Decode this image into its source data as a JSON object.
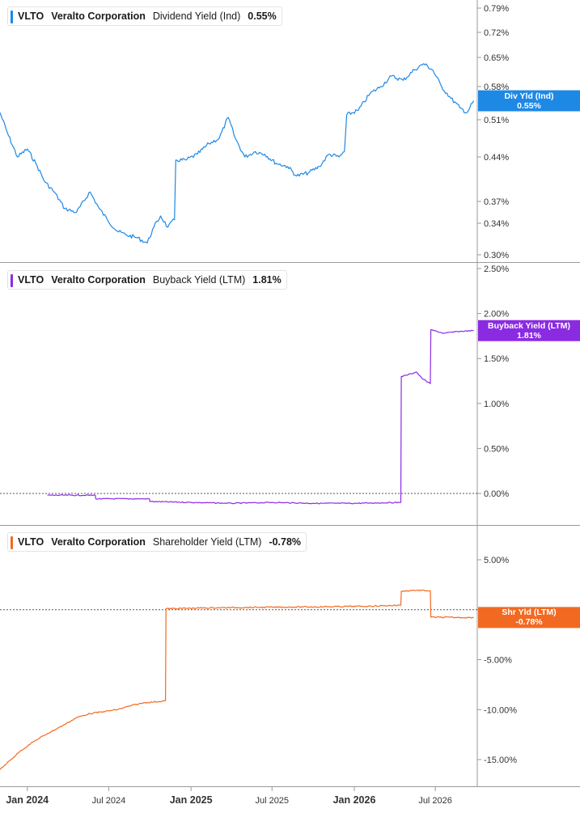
{
  "colors": {
    "dividend": "#1e88e5",
    "buyback": "#8a2be2",
    "shareholder": "#f26a21",
    "grid": "#c8c8c8",
    "axis_text": "#333333"
  },
  "legends": [
    {
      "ticker": "VLTO",
      "company": "Veralto Corporation",
      "metric": "Dividend Yield (Ind)",
      "value": "0.55%"
    },
    {
      "ticker": "VLTO",
      "company": "Veralto Corporation",
      "metric": "Buyback Yield (LTM)",
      "value": "1.81%"
    },
    {
      "ticker": "VLTO",
      "company": "Veralto Corporation",
      "metric": "Shareholder Yield (LTM)",
      "value": "-0.78%"
    }
  ],
  "flags": [
    {
      "line1": "Div Yld (Ind)",
      "line2": "0.55%"
    },
    {
      "line1": "Buyback Yield (LTM)",
      "line2": "1.81%"
    },
    {
      "line1": "Shr Yld (LTM)",
      "line2": "-0.78%"
    }
  ],
  "x_axis": {
    "labels": [
      {
        "text": "Jan 2024",
        "date": "2024-01-01",
        "bold": true
      },
      {
        "text": "Jul 2024",
        "date": "2024-07-01",
        "bold": false
      },
      {
        "text": "Jan 2025",
        "date": "2025-01-01",
        "bold": true
      },
      {
        "text": "Jul 2025",
        "date": "2025-07-01",
        "bold": false
      },
      {
        "text": "Jan 2026",
        "date": "2026-01-01",
        "bold": true
      },
      {
        "text": "Jul 2026",
        "date": "2026-07-01",
        "bold": false
      }
    ]
  },
  "chart_data": [
    {
      "type": "line",
      "series": [
        {
          "name": "Dividend Yield (Ind)",
          "points": [
            [
              "2023-11-01",
              0.525
            ],
            [
              "2023-11-20",
              0.48
            ],
            [
              "2023-12-10",
              0.44
            ],
            [
              "2024-01-01",
              0.455
            ],
            [
              "2024-01-20",
              0.43
            ],
            [
              "2024-02-10",
              0.4
            ],
            [
              "2024-03-01",
              0.385
            ],
            [
              "2024-03-25",
              0.36
            ],
            [
              "2024-04-20",
              0.355
            ],
            [
              "2024-05-20",
              0.385
            ],
            [
              "2024-06-10",
              0.36
            ],
            [
              "2024-06-28",
              0.345
            ],
            [
              "2024-07-20",
              0.33
            ],
            [
              "2024-08-10",
              0.325
            ],
            [
              "2024-09-01",
              0.322
            ],
            [
              "2024-09-25",
              0.315
            ],
            [
              "2024-10-10",
              0.335
            ],
            [
              "2024-10-25",
              0.35
            ],
            [
              "2024-11-10",
              0.335
            ],
            [
              "2024-11-25",
              0.345
            ],
            [
              "2024-11-28",
              0.435
            ],
            [
              "2024-12-20",
              0.435
            ],
            [
              "2025-01-15",
              0.445
            ],
            [
              "2025-02-10",
              0.465
            ],
            [
              "2025-03-05",
              0.475
            ],
            [
              "2025-03-25",
              0.515
            ],
            [
              "2025-04-10",
              0.475
            ],
            [
              "2025-05-01",
              0.44
            ],
            [
              "2025-05-25",
              0.45
            ],
            [
              "2025-06-15",
              0.445
            ],
            [
              "2025-07-10",
              0.43
            ],
            [
              "2025-08-05",
              0.425
            ],
            [
              "2025-08-25",
              0.41
            ],
            [
              "2025-09-20",
              0.415
            ],
            [
              "2025-10-15",
              0.425
            ],
            [
              "2025-11-05",
              0.445
            ],
            [
              "2025-11-28",
              0.44
            ],
            [
              "2025-12-10",
              0.45
            ],
            [
              "2025-12-15",
              0.52
            ],
            [
              "2026-01-10",
              0.53
            ],
            [
              "2026-02-05",
              0.565
            ],
            [
              "2026-03-01",
              0.58
            ],
            [
              "2026-03-25",
              0.605
            ],
            [
              "2026-04-20",
              0.595
            ],
            [
              "2026-05-15",
              0.62
            ],
            [
              "2026-06-05",
              0.635
            ],
            [
              "2026-06-25",
              0.62
            ],
            [
              "2026-07-15",
              0.58
            ],
            [
              "2026-08-05",
              0.555
            ],
            [
              "2026-08-25",
              0.535
            ],
            [
              "2026-09-10",
              0.525
            ],
            [
              "2026-09-25",
              0.55
            ]
          ]
        }
      ],
      "y_ticks": [
        "0.79%",
        "0.72%",
        "0.65%",
        "0.58%",
        "0.51%",
        "0.44%",
        "0.37%",
        "0.34%",
        "0.30%"
      ],
      "y_tick_values": [
        0.79,
        0.72,
        0.65,
        0.58,
        0.51,
        0.44,
        0.37,
        0.34,
        0.3
      ]
    },
    {
      "type": "line",
      "series": [
        {
          "name": "Buyback Yield (LTM)",
          "points": [
            [
              "2024-02-15",
              -0.02
            ],
            [
              "2024-06-01",
              -0.02
            ],
            [
              "2024-06-02",
              -0.06
            ],
            [
              "2024-09-30",
              -0.06
            ],
            [
              "2024-10-01",
              -0.09
            ],
            [
              "2025-01-01",
              -0.1
            ],
            [
              "2025-04-01",
              -0.11
            ],
            [
              "2025-07-01",
              -0.1
            ],
            [
              "2025-10-01",
              -0.11
            ],
            [
              "2026-01-01",
              -0.11
            ],
            [
              "2026-04-15",
              -0.1
            ],
            [
              "2026-04-16",
              1.3
            ],
            [
              "2026-05-01",
              1.32
            ],
            [
              "2026-05-20",
              1.35
            ],
            [
              "2026-06-01",
              1.28
            ],
            [
              "2026-06-20",
              1.22
            ],
            [
              "2026-06-21",
              1.82
            ],
            [
              "2026-07-20",
              1.78
            ],
            [
              "2026-08-20",
              1.8
            ],
            [
              "2026-09-25",
              1.81
            ]
          ]
        }
      ],
      "y_ticks": [
        "2.50%",
        "2.00%",
        "1.50%",
        "1.00%",
        "0.50%",
        "0.00%"
      ],
      "y_tick_values": [
        2.5,
        2.0,
        1.5,
        1.0,
        0.5,
        0.0
      ]
    },
    {
      "type": "line",
      "series": [
        {
          "name": "Shareholder Yield (LTM)",
          "points": [
            [
              "2023-11-01",
              -16.0
            ],
            [
              "2023-12-15",
              -14.2
            ],
            [
              "2024-01-15",
              -13.2
            ],
            [
              "2024-02-15",
              -12.4
            ],
            [
              "2024-03-20",
              -11.6
            ],
            [
              "2024-04-20",
              -10.8
            ],
            [
              "2024-05-20",
              -10.4
            ],
            [
              "2024-06-20",
              -10.2
            ],
            [
              "2024-07-20",
              -10.0
            ],
            [
              "2024-08-20",
              -9.6
            ],
            [
              "2024-09-20",
              -9.3
            ],
            [
              "2024-10-20",
              -9.2
            ],
            [
              "2024-11-05",
              -9.1
            ],
            [
              "2024-11-06",
              0.1
            ],
            [
              "2025-03-01",
              0.2
            ],
            [
              "2025-07-01",
              0.25
            ],
            [
              "2025-11-01",
              0.3
            ],
            [
              "2026-02-01",
              0.35
            ],
            [
              "2026-04-15",
              0.45
            ],
            [
              "2026-04-16",
              1.85
            ],
            [
              "2026-05-15",
              1.95
            ],
            [
              "2026-06-20",
              1.9
            ],
            [
              "2026-06-21",
              -0.75
            ],
            [
              "2026-08-20",
              -0.78
            ],
            [
              "2026-09-25",
              -0.78
            ]
          ]
        }
      ],
      "y_ticks": [
        "5.00%",
        "0.00%",
        "-5.00%",
        "-10.00%",
        "-15.00%"
      ],
      "y_tick_values": [
        5,
        0,
        -5,
        -10,
        -15
      ]
    }
  ]
}
